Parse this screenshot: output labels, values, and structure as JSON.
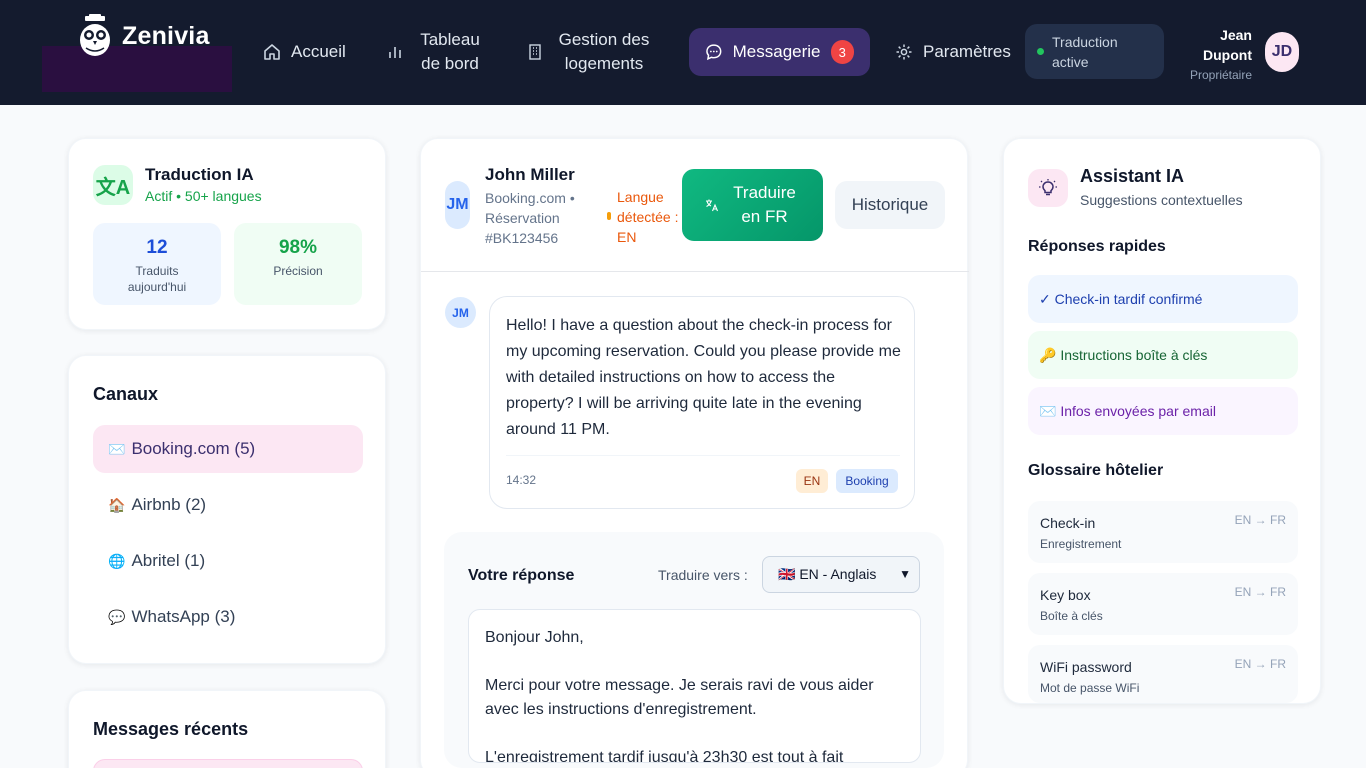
{
  "nav": {
    "brand": "Zenivia",
    "items": [
      {
        "label": "Accueil",
        "icon": "home-icon"
      },
      {
        "label": "Tableau de bord",
        "icon": "bar-chart-icon"
      },
      {
        "label": "Gestion des logements",
        "icon": "building-icon"
      },
      {
        "label": "Messagerie",
        "icon": "message-icon",
        "badge": "3"
      },
      {
        "label": "Paramètres",
        "icon": "gear-icon"
      }
    ],
    "translation_status": "Traduction active",
    "user_first": "Jean",
    "user_last": "Dupont",
    "user_role": "Propriétaire",
    "user_initials": "JD"
  },
  "translation_card": {
    "icon_glyph": "文A",
    "title": "Traduction IA",
    "subtitle": "Actif • 50+ langues",
    "stats": [
      {
        "value": "12",
        "caption": "Traduits aujourd'hui"
      },
      {
        "value": "98%",
        "caption": "Précision"
      }
    ]
  },
  "channels": {
    "title": "Canaux",
    "items": [
      {
        "emoji": "✉️",
        "label": "Booking.com (5)"
      },
      {
        "emoji": "🏠",
        "label": "Airbnb (2)"
      },
      {
        "emoji": "🌐",
        "label": "Abritel (1)"
      },
      {
        "emoji": "💬",
        "label": "WhatsApp (3)"
      }
    ]
  },
  "recent": {
    "title": "Messages récents"
  },
  "conversation": {
    "initials": "JM",
    "name": "John Miller",
    "meta": "Booking.com • Réservation #BK123456",
    "detected": "Langue détectée : EN",
    "translate_button": "Traduire en FR",
    "history_button": "Historique",
    "message": {
      "text": "Hello! I have a question about the check-in process for my upcoming reservation. Could you please provide me with detailed instructions on how to access the property? I will be arriving quite late in the evening around 11 PM.",
      "time": "14:32",
      "tags": [
        "EN",
        "Booking"
      ]
    }
  },
  "reply": {
    "title": "Votre réponse",
    "translate_to_label": "Traduire vers :",
    "selected_language": "🇬🇧 EN - Anglais",
    "paragraphs": [
      "Bonjour John,",
      "Merci pour votre message. Je serais ravi de vous aider avec les instructions d'enregistrement.",
      "L'enregistrement tardif jusqu'à 23h30 est tout à fait"
    ]
  },
  "assistant": {
    "title": "Assistant IA",
    "subtitle": "Suggestions contextuelles",
    "quick_title": "Réponses rapides",
    "quick": [
      {
        "label": "✓ Check-in tardif confirmé",
        "bg": "#eff6ff",
        "color": "#1e40af"
      },
      {
        "label": "🔑 Instructions boîte à clés",
        "bg": "#f0fdf4",
        "color": "#166534"
      },
      {
        "label": "✉️ Infos envoyées par email",
        "bg": "#faf5ff",
        "color": "#6b21a8"
      }
    ],
    "glossary_title": "Glossaire hôtelier",
    "glossary": [
      {
        "term": "Check-in",
        "translation": "Enregistrement",
        "dir": "EN → FR"
      },
      {
        "term": "Key box",
        "translation": "Boîte à clés",
        "dir": "EN → FR"
      },
      {
        "term": "WiFi password",
        "translation": "Mot de passe WiFi",
        "dir": "EN → FR"
      }
    ]
  },
  "colors": {
    "topbar": "#141b2e",
    "accent_purple": "#3b2f6e",
    "green": "#10b981",
    "badge_red": "#ef4444"
  }
}
